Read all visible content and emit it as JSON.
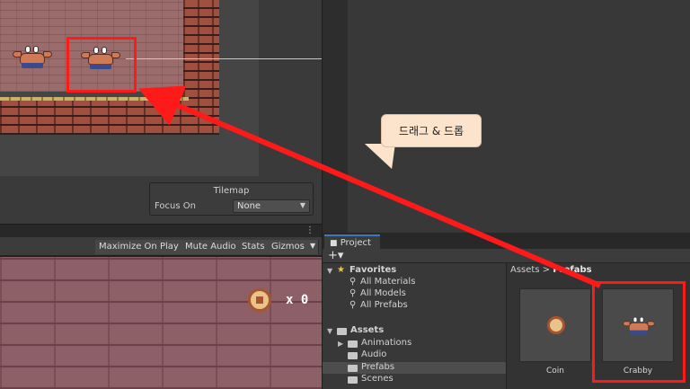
{
  "scene": {
    "tilemap_overlay": {
      "title": "Tilemap",
      "focus_label": "Focus On",
      "focus_value": "None"
    }
  },
  "game_view": {
    "toolbar": {
      "maximize_on_play": "Maximize On Play",
      "mute_audio": "Mute Audio",
      "stats": "Stats",
      "gizmos": "Gizmos"
    },
    "coin_counter": "x 0"
  },
  "annotation": {
    "callout_text": "드래그 & 드롭",
    "accent_color": "#ff1a1a",
    "callout_color": "#fbe3cc"
  },
  "project": {
    "tab_label": "Project",
    "add_label": "+▾",
    "favorites": {
      "label": "Favorites",
      "items": [
        "All Materials",
        "All Models",
        "All Prefabs"
      ]
    },
    "assets": {
      "label": "Assets",
      "folders": [
        "Animations",
        "Audio",
        "Prefabs",
        "Scenes"
      ],
      "selected_folder": "Prefabs"
    },
    "breadcrumb": {
      "root": "Assets",
      "separator": ">",
      "current": "Prefabs"
    },
    "prefabs": [
      {
        "name": "Coin",
        "icon": "coin-icon"
      },
      {
        "name": "Crabby",
        "icon": "crab-icon"
      }
    ]
  }
}
